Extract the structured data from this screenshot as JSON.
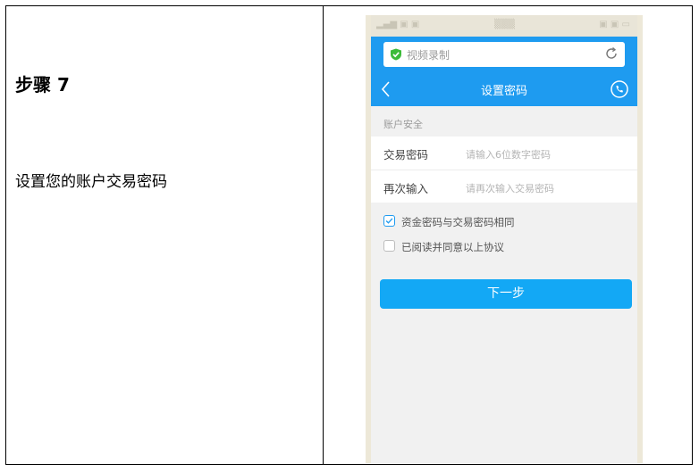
{
  "step": {
    "title": "步骤 7",
    "description": "设置您的账户交易密码"
  },
  "phone": {
    "url_bar": {
      "text": "视频录制"
    },
    "nav": {
      "title": "设置密码"
    },
    "section_label": "账户安全",
    "fields": [
      {
        "label": "交易密码",
        "placeholder": "请输入6位数字密码"
      },
      {
        "label": "再次输入",
        "placeholder": "请再次输入交易密码"
      }
    ],
    "checkboxes": [
      {
        "label": "资金密码与交易密码相同",
        "checked": true
      },
      {
        "label": "已阅读并同意以上协议",
        "checked": false
      }
    ],
    "next_button": "下一步",
    "colors": {
      "accent": "#1e9bf0",
      "button": "#13a8f5",
      "shield": "#3dbb3a"
    }
  }
}
